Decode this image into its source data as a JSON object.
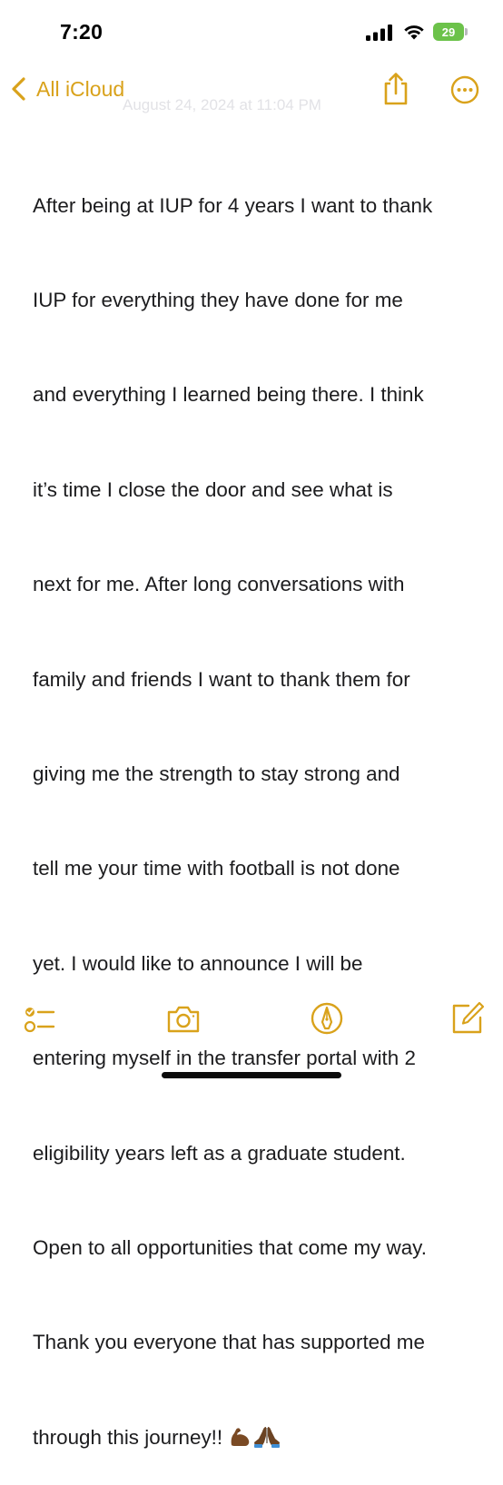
{
  "status_bar": {
    "time": "7:20",
    "battery_level": "29"
  },
  "nav": {
    "back_label": "All iCloud",
    "date": "August 24, 2024 at 11:04 PM"
  },
  "note": {
    "lines": [
      "After being at IUP for 4 years I want to thank",
      "IUP for everything they have done for me",
      "and everything I learned being there. I think",
      "it’s time I close the door and see what is",
      "next for me. After long conversations with",
      "family and friends I want to thank them for",
      "giving me the strength to stay strong and",
      "tell me your time with football is not done",
      "yet. I would like to announce I will be",
      "entering myself in the transfer portal with 2",
      "eligibility years left as a graduate student.",
      "Open to all opportunities that come my way.",
      "Thank you everyone that has supported me",
      "through this journey!! "
    ],
    "emoji_icons": [
      "flexed-biceps",
      "folded-hands"
    ]
  },
  "colors": {
    "accent": "#D9A21B",
    "battery": "#6CC24A",
    "text": "#1C1C1E",
    "date_faded": "#E2E2E6"
  },
  "toolbar": {
    "icons": [
      "checklist-icon",
      "camera-icon",
      "markup-icon",
      "compose-icon"
    ]
  }
}
